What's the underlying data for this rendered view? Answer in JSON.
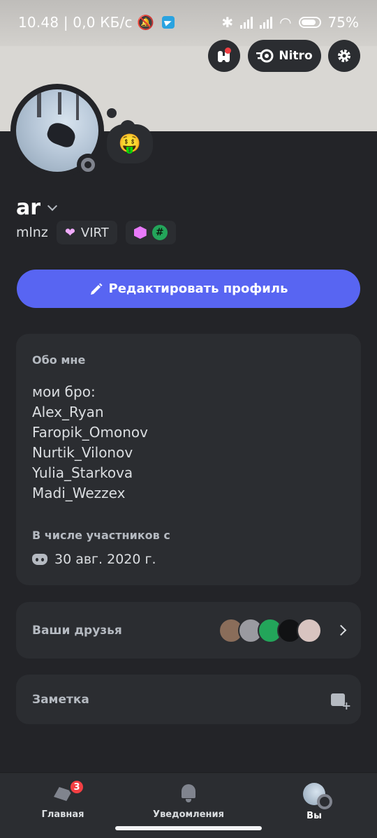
{
  "status_bar": {
    "time": "10.48 | 0,0 КБ/с",
    "battery": "75%"
  },
  "header": {
    "nitro_label": "Nitro"
  },
  "profile": {
    "display_name": "ar",
    "username": "mlnz",
    "status_emoji": "🤑",
    "tag_label": "VIRT"
  },
  "edit_button": {
    "label": "Редактировать профиль"
  },
  "about": {
    "heading": "Обо мне",
    "bio": "мои бро:\nAlex_Ryan\nFaropik_Omonov\nNurtik_Vilonov\nYulia_Starkova\nMadi_Wezzex",
    "member_since_heading": "В числе участников с",
    "member_since": "30 авг. 2020 г."
  },
  "friends": {
    "label": "Ваши друзья",
    "avatar_colors": [
      "#8a6d5a",
      "#9a9aa0",
      "#23a55a",
      "#111214",
      "#d8c4c0"
    ]
  },
  "note": {
    "label": "Заметка"
  },
  "tabs": {
    "home": {
      "label": "Главная",
      "badge": "3"
    },
    "notifications": {
      "label": "Уведомления"
    },
    "you": {
      "label": "Вы"
    }
  },
  "colors": {
    "accent": "#5865f2",
    "background": "#232428",
    "card": "#2b2d31",
    "badge": "#f23f43"
  }
}
